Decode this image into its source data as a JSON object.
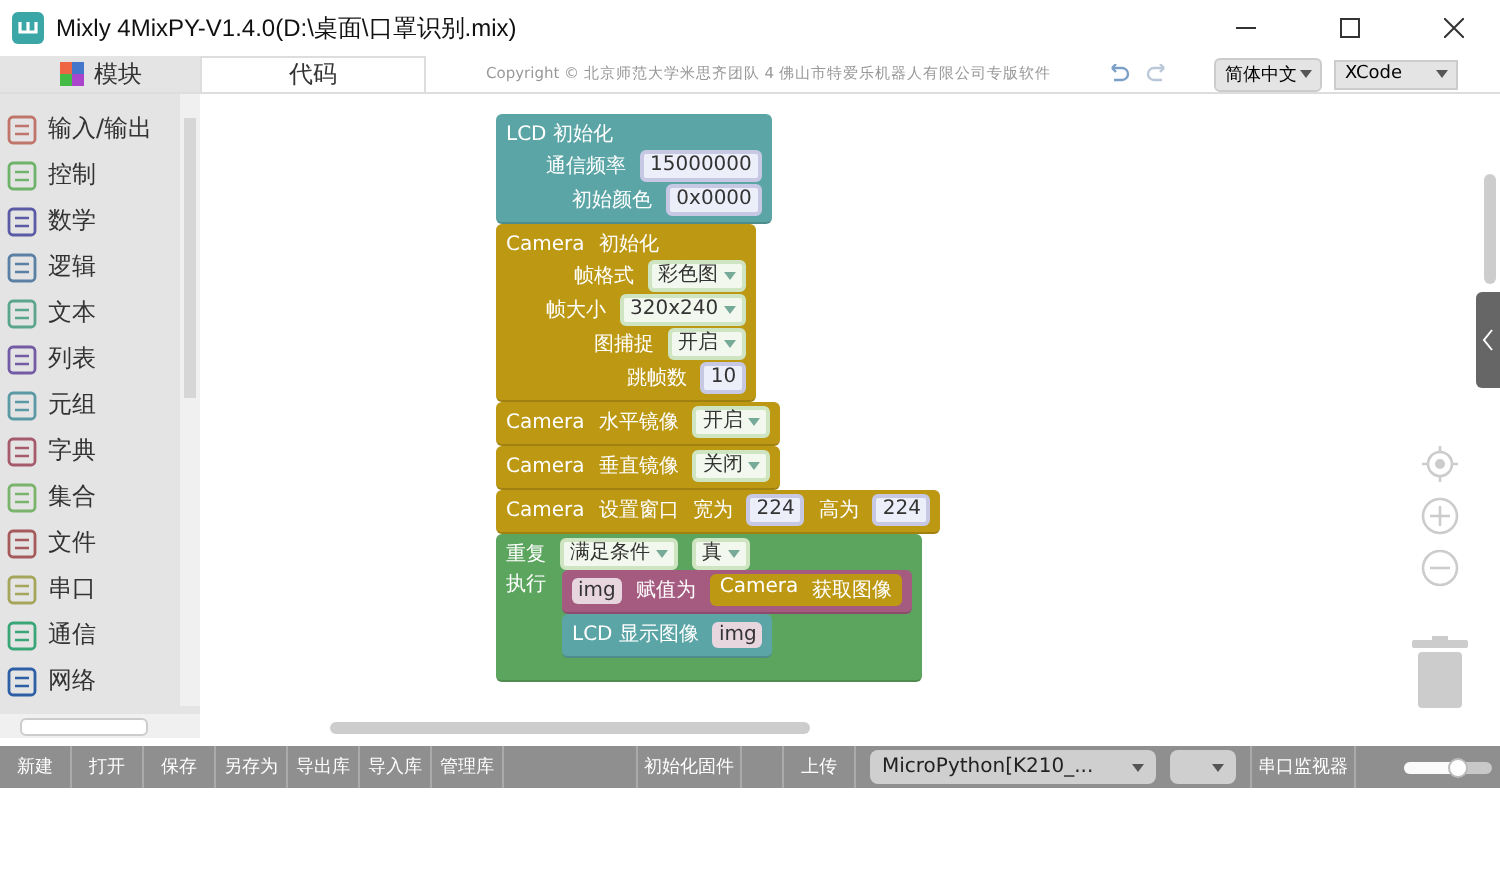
{
  "window": {
    "title": "Mixly 4MixPY-V1.4.0(D:\\桌面\\口罩识别.mix)"
  },
  "tabs": [
    {
      "label": "模块",
      "selected": true
    },
    {
      "label": "代码",
      "selected": false
    }
  ],
  "copyright": "Copyright © 北京师范大学米思齐团队 4 佛山市特爱乐机器人有限公司专版软件",
  "language_button": "简体中文",
  "theme_select": "XCode",
  "sidebar": {
    "items": [
      {
        "label": "输入/输出",
        "color": "#c0756b"
      },
      {
        "label": "控制",
        "color": "#6fb36b"
      },
      {
        "label": "数学",
        "color": "#5b5ba5"
      },
      {
        "label": "逻辑",
        "color": "#5b80a5"
      },
      {
        "label": "文本",
        "color": "#5ba58c"
      },
      {
        "label": "列表",
        "color": "#745ba5"
      },
      {
        "label": "元组",
        "color": "#5b9aa5"
      },
      {
        "label": "字典",
        "color": "#a55b6b"
      },
      {
        "label": "集合",
        "color": "#7ab36b"
      },
      {
        "label": "文件",
        "color": "#a55b5b"
      },
      {
        "label": "串口",
        "color": "#a5a55b"
      },
      {
        "label": "通信",
        "color": "#3aa577"
      },
      {
        "label": "网络",
        "color": "#2d5fa5"
      }
    ]
  },
  "blocks": [
    {
      "kind": "lcd",
      "head": [
        {
          "kind": "label",
          "text": "LCD 初始化"
        }
      ],
      "params": [
        [
          {
            "kind": "label",
            "text": "通信频率"
          },
          {
            "kind": "number",
            "text": "15000000"
          }
        ],
        [
          {
            "kind": "label",
            "text": "初始颜色"
          },
          {
            "kind": "number",
            "text": "0x0000"
          }
        ]
      ]
    },
    {
      "kind": "camera",
      "head": [
        {
          "kind": "label",
          "text": "Camera"
        },
        {
          "kind": "label",
          "text": "初始化"
        }
      ],
      "params": [
        [
          {
            "kind": "label",
            "text": "帧格式"
          },
          {
            "kind": "dropdown",
            "text": "彩色图"
          }
        ],
        [
          {
            "kind": "label",
            "text": "帧大小"
          },
          {
            "kind": "dropdown",
            "text": "320x240"
          }
        ],
        [
          {
            "kind": "label",
            "text": "图捕捉"
          },
          {
            "kind": "dropdown",
            "text": "开启"
          }
        ],
        [
          {
            "kind": "label",
            "text": "跳帧数"
          },
          {
            "kind": "number",
            "text": "10"
          }
        ]
      ]
    },
    {
      "kind": "camera",
      "head": [
        {
          "kind": "label",
          "text": "Camera"
        },
        {
          "kind": "label",
          "text": "水平镜像"
        },
        {
          "kind": "dropdown",
          "text": "开启"
        }
      ]
    },
    {
      "kind": "camera",
      "head": [
        {
          "kind": "label",
          "text": "Camera"
        },
        {
          "kind": "label",
          "text": "垂直镜像"
        },
        {
          "kind": "dropdown",
          "text": "关闭"
        }
      ]
    },
    {
      "kind": "camera",
      "head": [
        {
          "kind": "label",
          "text": "Camera"
        },
        {
          "kind": "label",
          "text": "设置窗口"
        },
        {
          "kind": "label",
          "text": "宽为"
        },
        {
          "kind": "number",
          "text": "224"
        },
        {
          "kind": "label",
          "text": "高为"
        },
        {
          "kind": "number",
          "text": "224"
        }
      ]
    },
    {
      "kind": "loop",
      "head": [
        {
          "kind": "label",
          "text": "重复"
        },
        {
          "kind": "dropdown",
          "text": "满足条件"
        },
        {
          "kind": "dropdown",
          "text": "真"
        }
      ],
      "body_label": "执行",
      "body": [
        {
          "kind": "variable",
          "head": [
            {
              "kind": "var",
              "text": "img"
            },
            {
              "kind": "label",
              "text": "赋值为"
            },
            {
              "kind": "block",
              "block": {
                "kind": "camera",
                "head": [
                  {
                    "kind": "label",
                    "text": "Camera"
                  },
                  {
                    "kind": "label",
                    "text": "获取图像"
                  }
                ]
              }
            }
          ]
        },
        {
          "kind": "lcd",
          "head": [
            {
              "kind": "label",
              "text": "LCD 显示图像"
            },
            {
              "kind": "var",
              "text": "img"
            }
          ]
        }
      ]
    }
  ],
  "toolbar": {
    "button_groups": [
      [
        "新建",
        "打开",
        "保存",
        "另存为",
        "导出库",
        "导入库",
        "管理库"
      ],
      [
        "初始化固件"
      ],
      [
        "上传"
      ]
    ],
    "board_select": "MicroPython[K210_...",
    "serial_monitor": "串口监视器",
    "zoom_slider": {
      "level": 0.62
    }
  }
}
